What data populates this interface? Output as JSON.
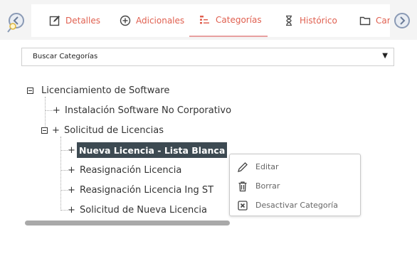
{
  "tabs": [
    {
      "label": "Detalles",
      "icon": "edit-icon"
    },
    {
      "label": "Adicionales",
      "icon": "plus-circle-icon"
    },
    {
      "label": "Categorías",
      "icon": "category-tree-icon",
      "active": true
    },
    {
      "label": "Histórico",
      "icon": "hourglass-icon"
    },
    {
      "label": "Car",
      "icon": "folder-icon"
    }
  ],
  "search": {
    "label": "Buscar Categorías",
    "caret": "▼"
  },
  "tree": {
    "root": "Licenciamiento de Software",
    "child1": "Instalación Software No Corporativo",
    "child2": "Solicitud de Licencias",
    "sub1": "Nueva Licencia - Lista Blanca",
    "sub2": "Reasignación Licencia",
    "sub3": "Reasignación Licencia Ing ST",
    "sub4": "Solicitud de Nueva Licencia"
  },
  "context_menu": {
    "edit": "Editar",
    "delete": "Borrar",
    "deactivate": "Desactivar Categoría"
  },
  "colors": {
    "accent": "#e06050",
    "selected_bg": "#3d4a52"
  }
}
